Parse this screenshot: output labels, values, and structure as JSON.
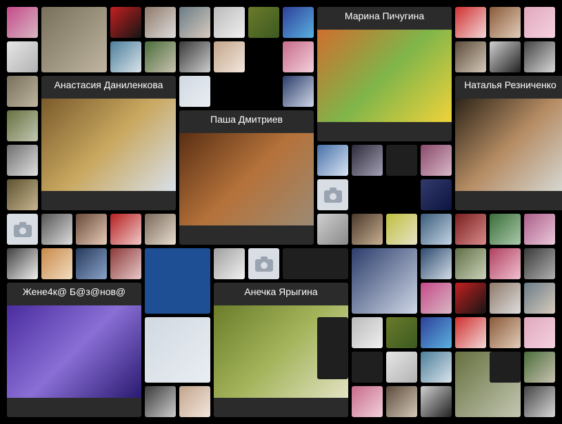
{
  "collage": {
    "featured": [
      {
        "id": "marina",
        "name": "Марина Пичугина",
        "colors": [
          "#cf6f2e",
          "#7fb54a",
          "#f0d23a"
        ]
      },
      {
        "id": "anastasia",
        "name": "Анастасия Даниленкова",
        "colors": [
          "#7a5b2b",
          "#c9a860",
          "#d8e0ea"
        ]
      },
      {
        "id": "natalya",
        "name": "Наталья Резниченко",
        "colors": [
          "#2d2418",
          "#b58c63",
          "#d7d9d4"
        ]
      },
      {
        "id": "pasha",
        "name": "Паша Дмитриев",
        "colors": [
          "#5a2f14",
          "#b5723a",
          "#9b8a73"
        ]
      },
      {
        "id": "zhenya",
        "name": "Жене4к@ Б@з@нов@",
        "colors": [
          "#4a2c9e",
          "#8a6fd6",
          "#2a1a70"
        ]
      },
      {
        "id": "anechka",
        "name": "Анечка Ярыгина",
        "colors": [
          "#6b7d2a",
          "#a3b45b",
          "#e3e3c3"
        ]
      }
    ],
    "thumbs": [
      {
        "colors": [
          "#c64a8a",
          "#d7b7c2"
        ]
      },
      {
        "colors": [
          "#c41f1f",
          "#151515"
        ]
      },
      {
        "colors": [
          "#8f7a6a",
          "#ddd"
        ]
      },
      {
        "colors": [
          "#6a7c87",
          "#d8cbbd"
        ]
      },
      {
        "colors": [
          "#bababa",
          "#f0f0f0"
        ]
      },
      {
        "colors": [
          "#6a7a2a",
          "#3c5a20"
        ]
      },
      {
        "colors": [
          "#2e3f98",
          "#5ab1e0"
        ]
      },
      {
        "colors": [
          "#d03030",
          "#f2d7d7"
        ]
      },
      {
        "colors": [
          "#8a5a3a",
          "#e2cdb9"
        ]
      },
      {
        "colors": [
          "#e1a8bd",
          "#f4d1df"
        ]
      },
      {
        "colors": [
          "#e6e6e6",
          "#b3b3b3"
        ]
      },
      {
        "colors": [
          "#4d7e9b",
          "#d9e4ea"
        ]
      },
      {
        "colors": [
          "#4a6d3b",
          "#c9c2b0"
        ]
      },
      {
        "colors": [
          "#3b3b3b",
          "#ccc"
        ]
      },
      {
        "colors": [
          "#c2a58c",
          "#f3e6dc"
        ]
      },
      {
        "colors": [
          "#c76b8a",
          "#f2d0dc"
        ]
      },
      {
        "colors": [
          "#5b4b3a",
          "#d5c8b8"
        ]
      },
      {
        "colors": [
          "#d0d0d0",
          "#222"
        ]
      },
      {
        "colors": [
          "#444",
          "#d8d8d8"
        ]
      },
      {
        "colors": [
          "#78705a",
          "#bfb5a1"
        ]
      },
      {
        "colors": [
          "#d1d8e0",
          "#e9eef3"
        ]
      },
      {
        "colors": [
          "#2c3d6b",
          "#cfd7e6"
        ]
      },
      {
        "colors": [
          "#66703f",
          "#c3c7b2"
        ]
      },
      {
        "colors": [
          "#6f6f6f",
          "#e0e0e0"
        ]
      },
      {
        "colors": [
          "#5e5230",
          "#c7b590"
        ]
      },
      {
        "colors": [
          "#4870a8",
          "#d9e5f4"
        ]
      },
      {
        "colors": [
          "#2d2a3a",
          "#a3a0b5"
        ]
      },
      {
        "colors": [
          "#8a4a6a",
          "#d8b7c8"
        ]
      },
      {
        "colors": [
          "#313b6b",
          "#0d1440"
        ]
      },
      {
        "colors": [
          "#555",
          "#ddd"
        ]
      },
      {
        "colors": [
          "#6a4a3a",
          "#e5cbb7"
        ]
      },
      {
        "colors": [
          "#b52020",
          "#f0c8c8"
        ]
      },
      {
        "colors": [
          "#7a6a5a",
          "#e8ddd0"
        ]
      },
      {
        "colors": [
          "#cfcfcf",
          "#8a8a8a"
        ]
      },
      {
        "colors": [
          "#4a3a2a",
          "#c8ae92"
        ]
      },
      {
        "colors": [
          "#bfbf3f",
          "#e6e2c6"
        ]
      },
      {
        "colors": [
          "#3c5c7a",
          "#c2d4e4"
        ]
      },
      {
        "colors": [
          "#7a1f1f",
          "#d98a8a"
        ]
      },
      {
        "colors": [
          "#3b6d3b",
          "#a9c9a9"
        ]
      },
      {
        "colors": [
          "#aa5f8a",
          "#ecc8da"
        ]
      },
      {
        "colors": [
          "#404040",
          "#f0f0f0"
        ]
      },
      {
        "colors": [
          "#c88a4a",
          "#f2dcc0"
        ]
      },
      {
        "colors": [
          "#273a5c",
          "#8aa2c8"
        ]
      },
      {
        "colors": [
          "#8c3a3a",
          "#e8c8c8"
        ]
      },
      {
        "colors": [
          "#9e9e9e",
          "#f2f2f2"
        ]
      },
      {
        "colors": [
          "#2d4a6d",
          "#d2dce8"
        ]
      },
      {
        "colors": [
          "#607047",
          "#cbd1b9"
        ]
      },
      {
        "colors": [
          "#b04060",
          "#f0c0d0"
        ]
      },
      {
        "colors": [
          "#3a3a3a",
          "#b0b0b0"
        ]
      }
    ]
  }
}
